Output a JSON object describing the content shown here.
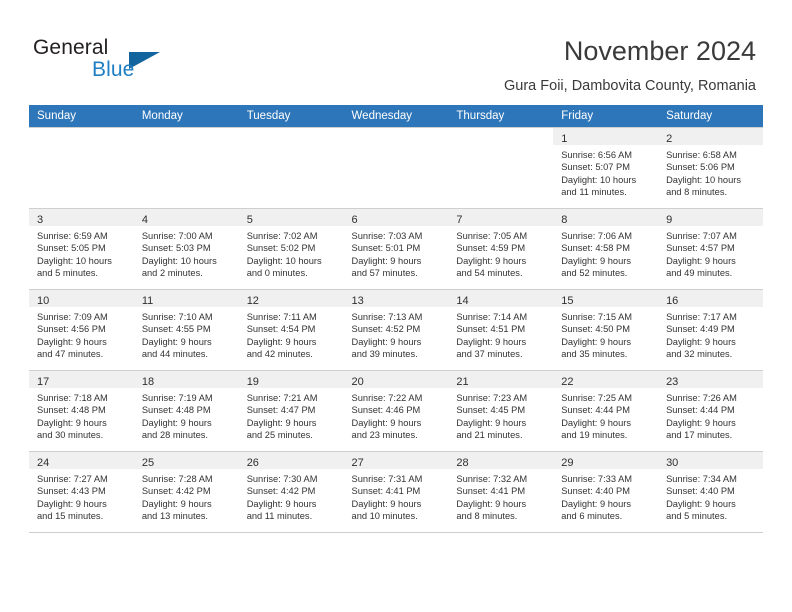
{
  "logo": {
    "line1": "General",
    "line2": "Blue",
    "triangle_color": "#12649f",
    "blue_color": "#1f7fc4"
  },
  "header": {
    "title": "November 2024",
    "subtitle": "Gura Foii, Dambovita County, Romania"
  },
  "theme": {
    "header_bg": "#2e76ba",
    "header_text": "#ffffff",
    "daynum_bar_bg": "#f0f0f0",
    "grid_line": "#cfcfcf"
  },
  "weekdays": [
    "Sunday",
    "Monday",
    "Tuesday",
    "Wednesday",
    "Thursday",
    "Friday",
    "Saturday"
  ],
  "weeks": [
    [
      {
        "empty": true
      },
      {
        "empty": true
      },
      {
        "empty": true
      },
      {
        "empty": true
      },
      {
        "empty": true
      },
      {
        "day": "1",
        "sunrise": "Sunrise: 6:56 AM",
        "sunset": "Sunset: 5:07 PM",
        "daylight_1": "Daylight: 10 hours",
        "daylight_2": "and 11 minutes."
      },
      {
        "day": "2",
        "sunrise": "Sunrise: 6:58 AM",
        "sunset": "Sunset: 5:06 PM",
        "daylight_1": "Daylight: 10 hours",
        "daylight_2": "and 8 minutes."
      }
    ],
    [
      {
        "day": "3",
        "sunrise": "Sunrise: 6:59 AM",
        "sunset": "Sunset: 5:05 PM",
        "daylight_1": "Daylight: 10 hours",
        "daylight_2": "and 5 minutes."
      },
      {
        "day": "4",
        "sunrise": "Sunrise: 7:00 AM",
        "sunset": "Sunset: 5:03 PM",
        "daylight_1": "Daylight: 10 hours",
        "daylight_2": "and 2 minutes."
      },
      {
        "day": "5",
        "sunrise": "Sunrise: 7:02 AM",
        "sunset": "Sunset: 5:02 PM",
        "daylight_1": "Daylight: 10 hours",
        "daylight_2": "and 0 minutes."
      },
      {
        "day": "6",
        "sunrise": "Sunrise: 7:03 AM",
        "sunset": "Sunset: 5:01 PM",
        "daylight_1": "Daylight: 9 hours",
        "daylight_2": "and 57 minutes."
      },
      {
        "day": "7",
        "sunrise": "Sunrise: 7:05 AM",
        "sunset": "Sunset: 4:59 PM",
        "daylight_1": "Daylight: 9 hours",
        "daylight_2": "and 54 minutes."
      },
      {
        "day": "8",
        "sunrise": "Sunrise: 7:06 AM",
        "sunset": "Sunset: 4:58 PM",
        "daylight_1": "Daylight: 9 hours",
        "daylight_2": "and 52 minutes."
      },
      {
        "day": "9",
        "sunrise": "Sunrise: 7:07 AM",
        "sunset": "Sunset: 4:57 PM",
        "daylight_1": "Daylight: 9 hours",
        "daylight_2": "and 49 minutes."
      }
    ],
    [
      {
        "day": "10",
        "sunrise": "Sunrise: 7:09 AM",
        "sunset": "Sunset: 4:56 PM",
        "daylight_1": "Daylight: 9 hours",
        "daylight_2": "and 47 minutes."
      },
      {
        "day": "11",
        "sunrise": "Sunrise: 7:10 AM",
        "sunset": "Sunset: 4:55 PM",
        "daylight_1": "Daylight: 9 hours",
        "daylight_2": "and 44 minutes."
      },
      {
        "day": "12",
        "sunrise": "Sunrise: 7:11 AM",
        "sunset": "Sunset: 4:54 PM",
        "daylight_1": "Daylight: 9 hours",
        "daylight_2": "and 42 minutes."
      },
      {
        "day": "13",
        "sunrise": "Sunrise: 7:13 AM",
        "sunset": "Sunset: 4:52 PM",
        "daylight_1": "Daylight: 9 hours",
        "daylight_2": "and 39 minutes."
      },
      {
        "day": "14",
        "sunrise": "Sunrise: 7:14 AM",
        "sunset": "Sunset: 4:51 PM",
        "daylight_1": "Daylight: 9 hours",
        "daylight_2": "and 37 minutes."
      },
      {
        "day": "15",
        "sunrise": "Sunrise: 7:15 AM",
        "sunset": "Sunset: 4:50 PM",
        "daylight_1": "Daylight: 9 hours",
        "daylight_2": "and 35 minutes."
      },
      {
        "day": "16",
        "sunrise": "Sunrise: 7:17 AM",
        "sunset": "Sunset: 4:49 PM",
        "daylight_1": "Daylight: 9 hours",
        "daylight_2": "and 32 minutes."
      }
    ],
    [
      {
        "day": "17",
        "sunrise": "Sunrise: 7:18 AM",
        "sunset": "Sunset: 4:48 PM",
        "daylight_1": "Daylight: 9 hours",
        "daylight_2": "and 30 minutes."
      },
      {
        "day": "18",
        "sunrise": "Sunrise: 7:19 AM",
        "sunset": "Sunset: 4:48 PM",
        "daylight_1": "Daylight: 9 hours",
        "daylight_2": "and 28 minutes."
      },
      {
        "day": "19",
        "sunrise": "Sunrise: 7:21 AM",
        "sunset": "Sunset: 4:47 PM",
        "daylight_1": "Daylight: 9 hours",
        "daylight_2": "and 25 minutes."
      },
      {
        "day": "20",
        "sunrise": "Sunrise: 7:22 AM",
        "sunset": "Sunset: 4:46 PM",
        "daylight_1": "Daylight: 9 hours",
        "daylight_2": "and 23 minutes."
      },
      {
        "day": "21",
        "sunrise": "Sunrise: 7:23 AM",
        "sunset": "Sunset: 4:45 PM",
        "daylight_1": "Daylight: 9 hours",
        "daylight_2": "and 21 minutes."
      },
      {
        "day": "22",
        "sunrise": "Sunrise: 7:25 AM",
        "sunset": "Sunset: 4:44 PM",
        "daylight_1": "Daylight: 9 hours",
        "daylight_2": "and 19 minutes."
      },
      {
        "day": "23",
        "sunrise": "Sunrise: 7:26 AM",
        "sunset": "Sunset: 4:44 PM",
        "daylight_1": "Daylight: 9 hours",
        "daylight_2": "and 17 minutes."
      }
    ],
    [
      {
        "day": "24",
        "sunrise": "Sunrise: 7:27 AM",
        "sunset": "Sunset: 4:43 PM",
        "daylight_1": "Daylight: 9 hours",
        "daylight_2": "and 15 minutes."
      },
      {
        "day": "25",
        "sunrise": "Sunrise: 7:28 AM",
        "sunset": "Sunset: 4:42 PM",
        "daylight_1": "Daylight: 9 hours",
        "daylight_2": "and 13 minutes."
      },
      {
        "day": "26",
        "sunrise": "Sunrise: 7:30 AM",
        "sunset": "Sunset: 4:42 PM",
        "daylight_1": "Daylight: 9 hours",
        "daylight_2": "and 11 minutes."
      },
      {
        "day": "27",
        "sunrise": "Sunrise: 7:31 AM",
        "sunset": "Sunset: 4:41 PM",
        "daylight_1": "Daylight: 9 hours",
        "daylight_2": "and 10 minutes."
      },
      {
        "day": "28",
        "sunrise": "Sunrise: 7:32 AM",
        "sunset": "Sunset: 4:41 PM",
        "daylight_1": "Daylight: 9 hours",
        "daylight_2": "and 8 minutes."
      },
      {
        "day": "29",
        "sunrise": "Sunrise: 7:33 AM",
        "sunset": "Sunset: 4:40 PM",
        "daylight_1": "Daylight: 9 hours",
        "daylight_2": "and 6 minutes."
      },
      {
        "day": "30",
        "sunrise": "Sunrise: 7:34 AM",
        "sunset": "Sunset: 4:40 PM",
        "daylight_1": "Daylight: 9 hours",
        "daylight_2": "and 5 minutes."
      }
    ]
  ]
}
